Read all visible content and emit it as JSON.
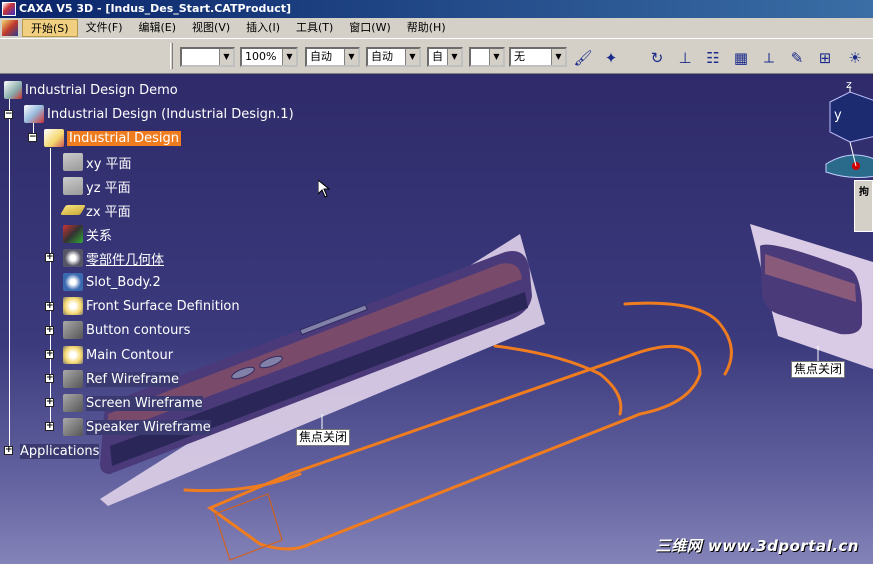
{
  "window": {
    "title": "CAXA V5 3D - [Indus_Des_Start.CATProduct]"
  },
  "menu": [
    {
      "label": "开始(S)",
      "active": true
    },
    {
      "label": "文件(F)"
    },
    {
      "label": "编辑(E)"
    },
    {
      "label": "视图(V)"
    },
    {
      "label": "插入(I)"
    },
    {
      "label": "工具(T)"
    },
    {
      "label": "窗口(W)"
    },
    {
      "label": "帮助(H)"
    }
  ],
  "toolbar": {
    "color_value": "",
    "transparency_value": "100%",
    "linetype_value": "自动",
    "thickness_value": "自动",
    "pointtype_value": "自",
    "layer_value": "",
    "rendering_value": "无"
  },
  "tree": {
    "root": "Industrial Design Demo",
    "product": "Industrial Design (Industrial Design.1)",
    "part": "Industrial Design",
    "items": [
      {
        "label": "xy 平面"
      },
      {
        "label": "yz 平面"
      },
      {
        "label": "zx 平面"
      },
      {
        "label": "关系"
      },
      {
        "label": "零部件几何体"
      },
      {
        "label": "Slot_Body.2"
      },
      {
        "label": "Front Surface Definition"
      },
      {
        "label": "Button contours"
      },
      {
        "label": "Main Contour"
      },
      {
        "label": "Ref Wireframe"
      },
      {
        "label": "Screen Wireframe"
      },
      {
        "label": "Speaker Wireframe"
      }
    ],
    "applications": "Applications"
  },
  "viewport": {
    "tag_left": "焦点关闭",
    "tag_right": "焦点关闭",
    "compass_y": "y",
    "compass_z": "z"
  },
  "side_panel": {
    "label": "拘"
  },
  "watermark": "三维网 www.3dportal.cn",
  "colors": {
    "accent_orange": "#f07c20",
    "viewport_bg": "#2f2b6a",
    "selection": "#f07c20"
  }
}
